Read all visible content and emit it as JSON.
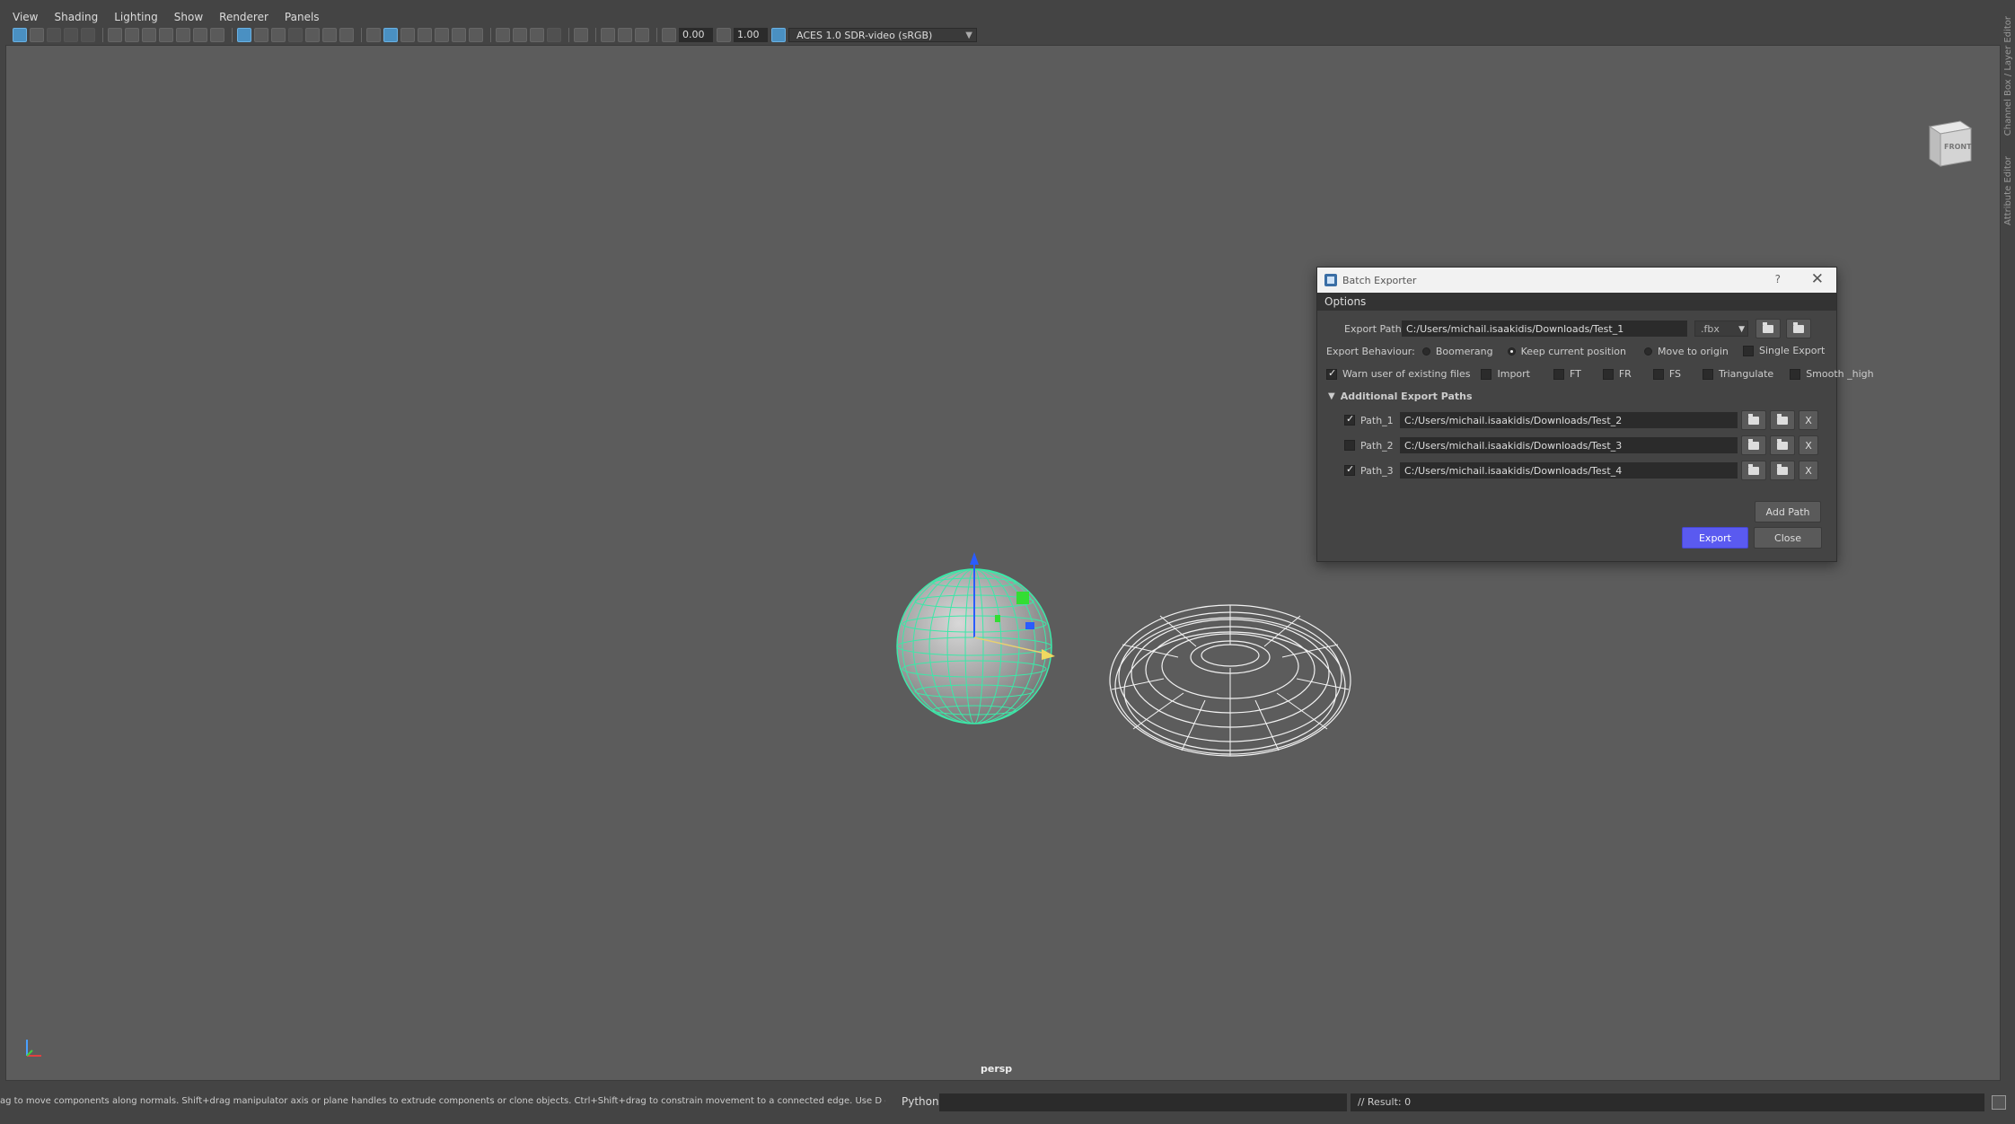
{
  "menubar": {
    "items": [
      "View",
      "Shading",
      "Lighting",
      "Show",
      "Renderer",
      "Panels"
    ]
  },
  "toolbar": {
    "exposure_value": "0.00",
    "gamma_value": "1.00",
    "color_space": "ACES 1.0 SDR-video (sRGB)"
  },
  "side_panel": {
    "tab1": "Channel Box / Layer Editor",
    "tab2": "Attribute Editor"
  },
  "viewport": {
    "camera_label": "persp",
    "viewcube_label": "FRONT"
  },
  "dialog": {
    "title": "Batch Exporter",
    "help": "?",
    "close_icon": "✕",
    "options_header": "Options",
    "export_path_label": "Export Path:",
    "export_path_value": "C:/Users/michail.isaakidis/Downloads/Test_1",
    "format_value": ".fbx",
    "export_behaviour_label": "Export Behaviour:",
    "behaviour_options": [
      {
        "label": "Boomerang",
        "selected": false
      },
      {
        "label": "Keep current position",
        "selected": true
      },
      {
        "label": "Move to origin",
        "selected": false
      }
    ],
    "single_export": {
      "label": "Single Export",
      "checked": false
    },
    "flags": [
      {
        "label": "Warn user of existing files",
        "checked": true
      },
      {
        "label": "Import",
        "checked": false
      },
      {
        "label": "FT",
        "checked": false
      },
      {
        "label": "FR",
        "checked": false
      },
      {
        "label": "FS",
        "checked": false
      },
      {
        "label": "Triangulate",
        "checked": false
      },
      {
        "label": "Smooth _high",
        "checked": false
      }
    ],
    "additional_header": "Additional Export Paths",
    "paths": [
      {
        "name": "Path_1",
        "checked": true,
        "value": "C:/Users/michail.isaakidis/Downloads/Test_2"
      },
      {
        "name": "Path_2",
        "checked": false,
        "value": "C:/Users/michail.isaakidis/Downloads/Test_3"
      },
      {
        "name": "Path_3",
        "checked": true,
        "value": "C:/Users/michail.isaakidis/Downloads/Test_4"
      }
    ],
    "remove_label": "X",
    "add_path_label": "Add Path",
    "export_label": "Export",
    "close_label": "Close"
  },
  "statusbar": {
    "help_text": "ag to move components along normals. Shift+drag manipulator axis or plane handles to extrude components or clone objects. Ctrl+Shift+drag to constrain movement to a connected edge. Use D or INSERT to change the piv",
    "python_label": "Python",
    "result_text": "// Result: 0"
  },
  "colors": {
    "accent": "#5a5af0",
    "selection_wire": "#3ce8a8",
    "viewport_bg": "#5c5c5c"
  }
}
